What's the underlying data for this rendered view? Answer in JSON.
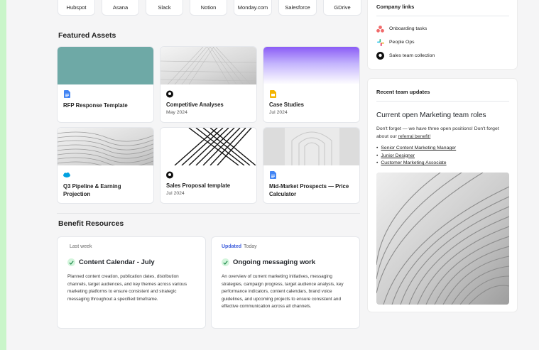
{
  "apps": [
    {
      "label": "Hubspot",
      "icon": "hubspot-icon",
      "color": "#ff7a59"
    },
    {
      "label": "Asana",
      "icon": "asana-icon",
      "color": "#f06a6a"
    },
    {
      "label": "Slack",
      "icon": "slack-icon",
      "color": "#e01e5a"
    },
    {
      "label": "Notion",
      "icon": "notion-icon",
      "color": "#222222"
    },
    {
      "label": "Monday.com",
      "icon": "monday-icon",
      "color": "#ff3d57"
    },
    {
      "label": "Salesforce",
      "icon": "salesforce-icon",
      "color": "#00a1e0"
    },
    {
      "label": "GDrive",
      "icon": "gdrive-icon",
      "color": "#4285f4"
    }
  ],
  "featured": {
    "title": "Featured Assets",
    "assets": [
      {
        "title": "RFP Response Template",
        "date": "",
        "icon": "google-docs-icon",
        "thumb": "teal"
      },
      {
        "title": "Competitive Analyses",
        "date": "May 2024",
        "icon": "github-icon",
        "thumb": "gray"
      },
      {
        "title": "Case Studies",
        "date": "Jul 2024",
        "icon": "google-slides-icon",
        "thumb": "purple"
      },
      {
        "title": "Q3 Pipeline & Earning Projection",
        "date": "",
        "icon": "salesforce-icon",
        "thumb": "gray"
      },
      {
        "title": "Sales Proposal template",
        "date": "Jul 2024",
        "icon": "github-icon",
        "thumb": "bw"
      },
      {
        "title": "Mid-Market Prospects — Price Calculator",
        "date": "",
        "icon": "google-docs-icon",
        "thumb": "light"
      }
    ]
  },
  "benefits": {
    "title": "Benefit Resources",
    "cards": [
      {
        "updated_label": "",
        "meta": "Last week",
        "title": "Content Calendar - July",
        "body": "Planned content creation, publication dates, distribution channels, target audiences, and key themes across various marketing platforms to ensure consistent and strategic messaging throughout a specified timeframe."
      },
      {
        "updated_label": "Updated",
        "meta": "Today",
        "title": "Ongoing messaging work",
        "body": "An overview of current marketing initiatives, messaging strategies, campaign progress, target audience analysis, key performance indicators, content calendars, brand voice guidelines, and upcoming projects to ensure consistent and effective communication across all channels."
      }
    ]
  },
  "company_links": {
    "title": "Company links",
    "items": [
      {
        "label": "Onboarding tasks",
        "icon": "asana-icon"
      },
      {
        "label": "People Ops",
        "icon": "slack-icon"
      },
      {
        "label": "Sales team collection",
        "icon": "github-icon"
      }
    ]
  },
  "updates": {
    "title": "Recent team updates",
    "headline": "Current open Marketing team roles",
    "text_before_link": "Don't forget — we have three open positions! Don't forget about our ",
    "link": "referral benefit!",
    "roles": [
      "Senior Content Marketing Manager",
      "Junior Designer",
      "Customer Marketing Associate"
    ]
  }
}
